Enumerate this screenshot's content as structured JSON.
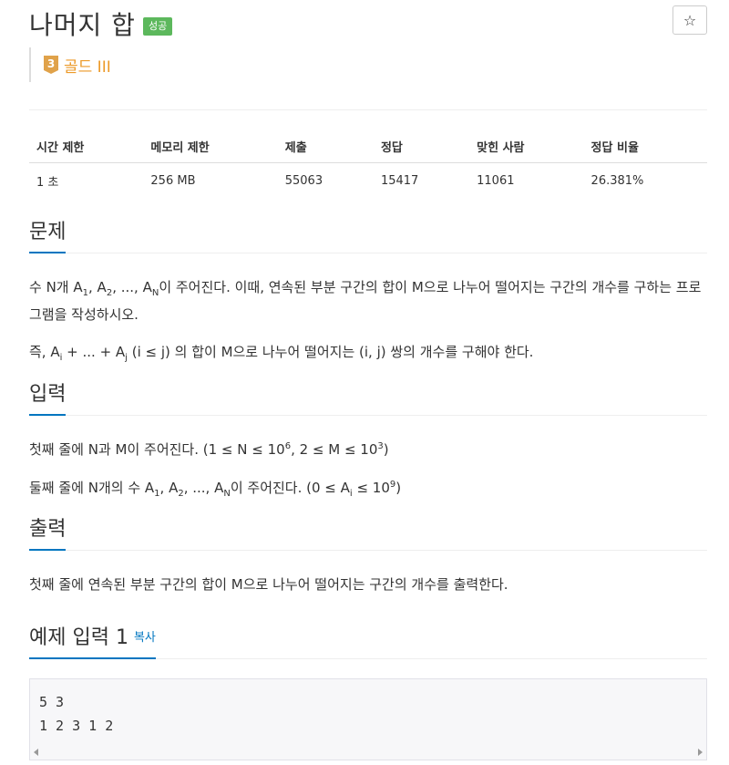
{
  "problem": {
    "title": "나머지 합",
    "status_badge": "성공",
    "star_icon": "☆",
    "tier": {
      "number": "3",
      "label": "골드 III",
      "color": "#ec9a29"
    }
  },
  "info_table": {
    "headers": [
      "시간 제한",
      "메모리 제한",
      "제출",
      "정답",
      "맞힌 사람",
      "정답 비율"
    ],
    "values": [
      "1 초",
      "256 MB",
      "55063",
      "15417",
      "11061",
      "26.381%"
    ]
  },
  "sections": {
    "problem": {
      "title": "문제",
      "p1_a": "수 N개 A",
      "p1_s1": "1",
      "p1_b": ", A",
      "p1_s2": "2",
      "p1_c": ", ..., A",
      "p1_sN": "N",
      "p1_d": "이 주어진다. 이때, 연속된 부분 구간의 합이 M으로 나누어 떨어지는 구간의 개수를 구하는 프로그램을 작성하시오.",
      "p2_a": "즉, A",
      "p2_si": "i",
      "p2_b": " + ... + A",
      "p2_sj": "j",
      "p2_c": " (i ≤ j) 의 합이 M으로 나누어 떨어지는 (i, j) 쌍의 개수를 구해야 한다."
    },
    "input": {
      "title": "입력",
      "l1_a": "첫째 줄에 N과 M이 주어진다. (1 ≤ N ≤ 10",
      "l1_s1": "6",
      "l1_b": ", 2 ≤ M ≤ 10",
      "l1_s2": "3",
      "l1_c": ")",
      "l2_a": "둘째 줄에 N개의 수 A",
      "l2_s1": "1",
      "l2_b": ", A",
      "l2_s2": "2",
      "l2_c": ", ..., A",
      "l2_sN": "N",
      "l2_d": "이 주어진다. (0 ≤ A",
      "l2_si": "i",
      "l2_e": " ≤ 10",
      "l2_s9": "9",
      "l2_f": ")"
    },
    "output": {
      "title": "출력",
      "text": "첫째 줄에 연속된 부분 구간의 합이 M으로 나누어 떨어지는 구간의 개수를 출력한다."
    },
    "sample_input": {
      "title": "예제 입력 1",
      "copy_label": "복사",
      "line1": "5 3",
      "line2": "1 2 3 1 2"
    }
  },
  "colors": {
    "badge": "#5cb85c",
    "accent": "#0076c0"
  }
}
